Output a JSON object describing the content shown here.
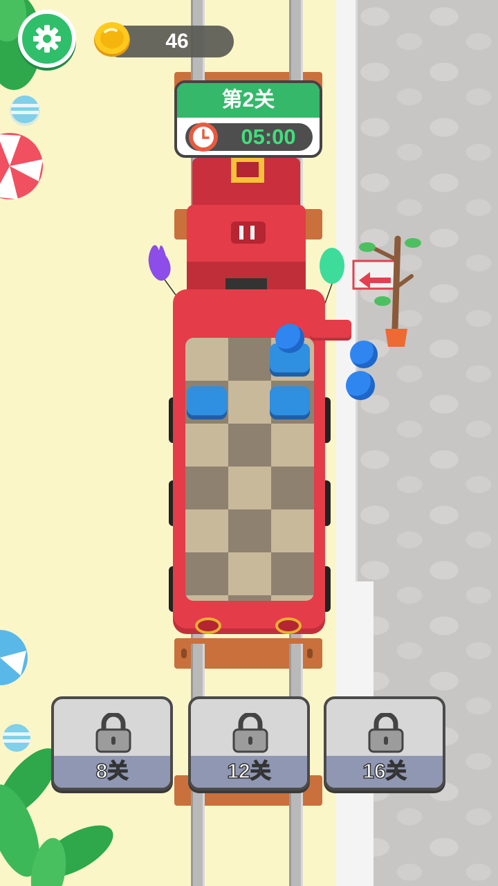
{
  "hud": {
    "coins": "46",
    "coin_icon": "gold-coin-icon",
    "settings_icon": "gear-icon"
  },
  "level_card": {
    "title": "第2关",
    "timer": "05:00",
    "timer_icon": "clock-icon"
  },
  "unlock_buttons": [
    {
      "label": "8关",
      "icon": "lock-icon"
    },
    {
      "label": "12关",
      "icon": "lock-icon"
    },
    {
      "label": "16关",
      "icon": "lock-icon"
    }
  ],
  "colors": {
    "train_red": "#e43c49",
    "accent_green": "#35b86a",
    "timer_green": "#3fe07a",
    "passenger_blue": "#2f86f0",
    "sand": "#fbf6c8"
  }
}
